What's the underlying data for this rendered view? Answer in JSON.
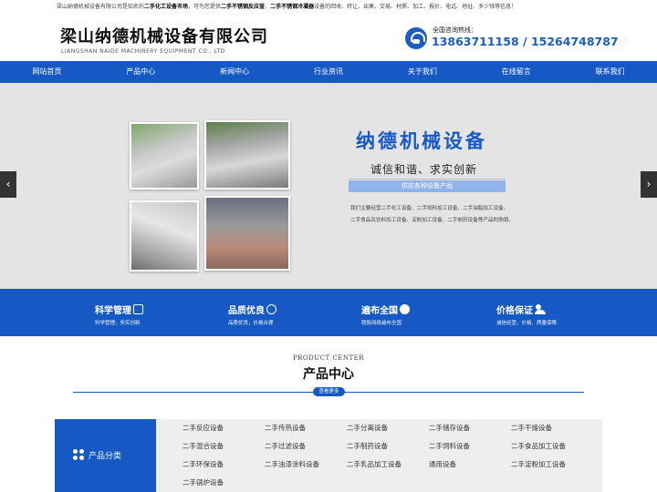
{
  "topbar": {
    "text_pre": "梁山纳德机械设备有限公司是知名的",
    "bold1": "二手化工设备市场",
    "text_mid": "，可为您提供",
    "bold2": "二手不锈钢反应釜",
    "sep": "、",
    "bold3": "二手不锈钢冷凝器",
    "text_post": "设备的回收、转让、出售、交易、材质、加工、报价、电话、地址、多少钱等信息！"
  },
  "header": {
    "title": "梁山纳德机械设备有限公司",
    "subtitle": "LIANGSHAN NAIDE MACHINERY EQUIPMENT CO., LTD",
    "hotline_label": "全国咨询热线：",
    "hotline_numbers": "13863711158 / 15264748787"
  },
  "nav": [
    "网站首页",
    "产品中心",
    "新闻中心",
    "行业资讯",
    "关于我们",
    "在线留言",
    "联系我们"
  ],
  "banner": {
    "title": "纳德机械设备",
    "slogan": "诚信和谐、求实创新",
    "chip": "供应各种设备产品",
    "desc_line1": "我们主要经营二手化工设备、二手饲料加工设备、二手油脂加工设备、",
    "desc_line2": "二手食品及饮料加工设备、淀粉加工设备、二手制药设备等产品的购销。",
    "prev": "‹",
    "next": "›"
  },
  "features": [
    {
      "title": "科学管理",
      "sub": "科学管理，务实创新",
      "icon": "chart-icon"
    },
    {
      "title": "品质优良",
      "sub": "品质优良，价格合理",
      "icon": "badge-icon"
    },
    {
      "title": "遍布全国",
      "sub": "销售网络遍布全国",
      "icon": "globe-icon"
    },
    {
      "title": "价格保证",
      "sub": "诚信经营，价格、质量保障",
      "icon": "people-icon"
    }
  ],
  "products": {
    "en_title": "PRODUCT CENTER",
    "cn_title": "产品中心",
    "more": "查看更多",
    "category_label": "产品分类",
    "categories": [
      "二手反应设备",
      "二手传热设备",
      "二手分离设备",
      "二手储存设备",
      "二手干燥设备",
      "二手混合设备",
      "二手过滤设备",
      "二手制药设备",
      "二手饲料设备",
      "二手食品加工设备",
      "二手环保设备",
      "二手油漆涂料设备",
      "二手乳品加工设备",
      "通用设备",
      "二手淀粉加工设备",
      "二手锅炉设备"
    ]
  },
  "colors": {
    "brand": "#1658c4",
    "banner_bg": "#e4e4e4",
    "chip": "#8fb4ea"
  }
}
